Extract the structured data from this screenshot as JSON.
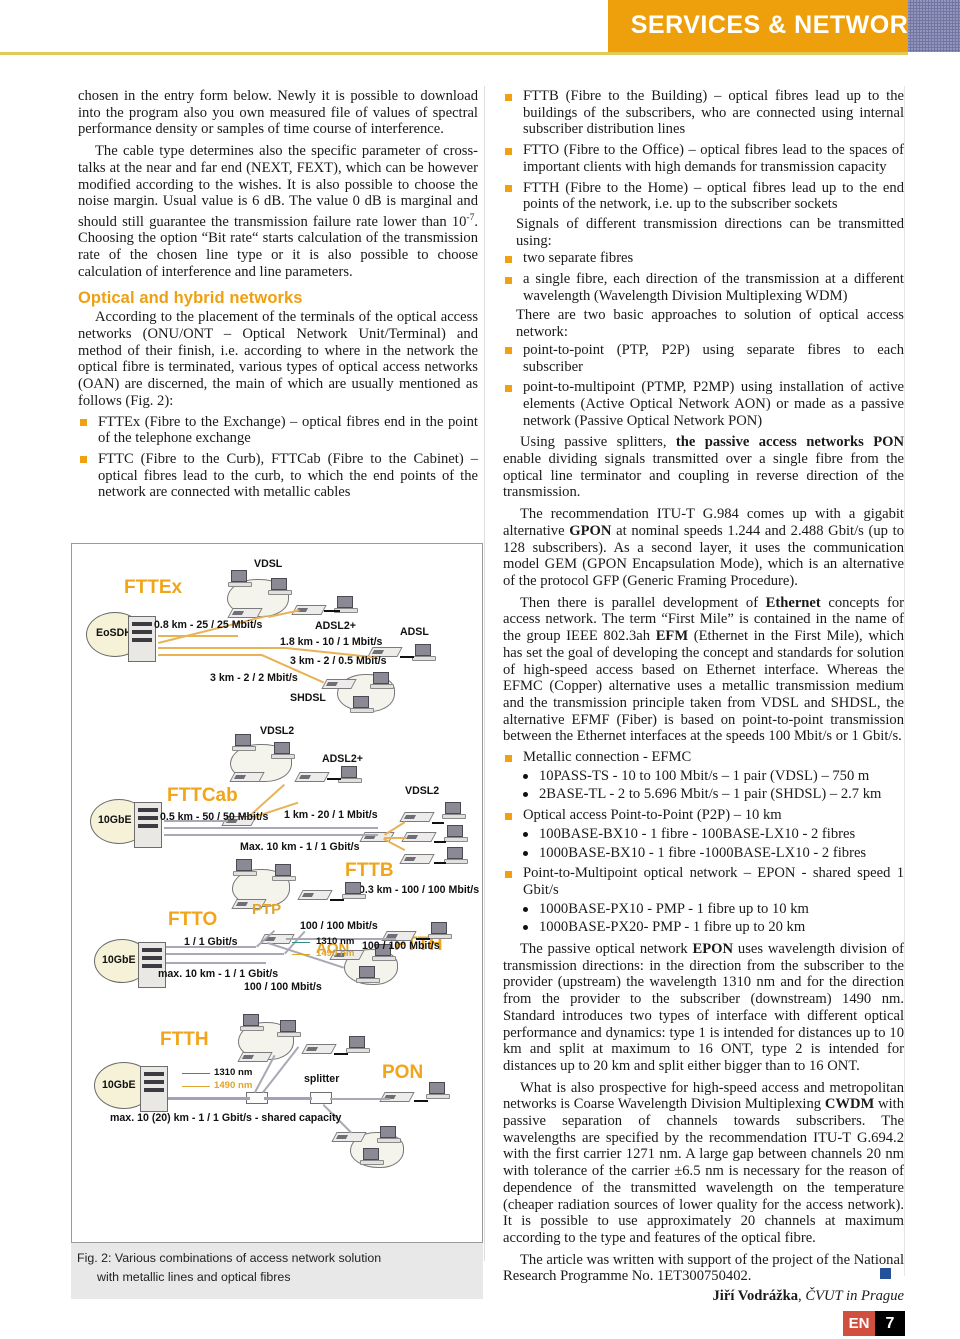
{
  "header": {
    "title": "SERVICES & NETWORKS"
  },
  "left_column": {
    "para1": "chosen in the entry form below. Newly it is possible to download into the program also you own measured file of values of spectral performance density or samples of time course of interference.",
    "para2_a": "The cable type determines also the specific parameter of cross-talks at the near and far end (NEXT, FEXT), which can be however modified according to the wishes. It is also possible to choose the noise margin. Usual value is 6 dB. The value 0 dB is marginal and should still guarantee the transmission failure rate lower than 10",
    "para2_sup": "-7",
    "para2_b": ". Choosing the option “Bit rate“ starts calculation of the transmission rate of the chosen line type or it is also possible to choose calculation of interference and line parameters.",
    "section_heading": "Optical and hybrid networks",
    "para3": "According to the placement of the terminals of the optical access networks (ONU/ONT – Optical Network Unit/Terminal) and method of their finish, i.e. according to where in the network the optical fibre is terminated, various types of optical access networks (OAN) are discerned, the main of which are usually mentioned as follows (Fig. 2):",
    "bullets": [
      "FTTEx (Fibre to the Exchange) – optical fibres end in the point of the telephone exchange",
      "FTTC (Fibre to the Curb), FTTCab (Fibre to the Cabinet) – optical fibres lead to the curb, to which the end points of the network are connected with metallic cables"
    ]
  },
  "right_column": {
    "bullets_top": [
      "FTTB (Fibre to the Building) – optical fibres lead up to the buildings of the subscribers, who are connected using internal subscriber distribution lines",
      "FTTO (Fibre to the Office) – optical fibres lead to the spaces of important clients with high demands for transmission capacity",
      "FTTH (Fibre to the Home) – optical fibres lead up to the end points of the network, i.e. up to the subscriber sockets"
    ],
    "lead_signals": "Signals of different transmission directions can be transmitted using:",
    "bullets_signals": [
      "two separate fibres",
      "a single fibre, each direction of the transmission at a different wavelength (Wavelength Division Multiplexing WDM)"
    ],
    "lead_approaches": "There are two basic approaches to solution of optical access network:",
    "bullets_approaches": [
      "point-to-point (PTP, P2P) using separate fibres to each subscriber",
      "point-to-multipoint (PTMP, P2MP) using installation of active elements (Active Optical Network AON) or made as a passive network (Passive Optical Network PON)"
    ],
    "para_pon_a": "Using passive splitters, ",
    "para_pon_bold": "the passive access networks PON",
    "para_pon_b": " enable dividing signals transmitted over a single fibre from the optical line terminator and coupling in reverse direction of the transmission.",
    "para_gpon_a": "The recommendation ITU-T G.984 comes up with a gigabit alternative ",
    "para_gpon_bold": "GPON",
    "para_gpon_b": " at nominal speeds 1.244 and 2.488 Gbit/s (up to 128 subscribers). As a second layer, it uses the communication model GEM (GPON Encapsulation Mode), which is an alternative of the protocol GFP (Generic Framing Procedure).",
    "para_eth_a": "Then there is parallel development of ",
    "para_eth_bold1": "Ethernet",
    "para_eth_b": " concepts for access network. The term “First Mile” is contained in the name of the group IEEE 802.3ah ",
    "para_eth_bold2": "EFM",
    "para_eth_c": " (Ethernet in the First Mile), which has set the goal of developing the concept and standards for solution of high-speed access based on Ethernet interface. Whereas the EFMC (Copper) alternative uses a metallic transmission medium and the transmission principle taken from VDSL and SHDSL, the alternative EFMF (Fiber) is based on point-to-point transmission between the Ethernet interfaces at the speeds 100 Mbit/s or 1 Gbit/s.",
    "spec_list": [
      {
        "label": "Metallic connection - EFMC",
        "subs": [
          "10PASS-TS - 10 to 100 Mbit/s – 1 pair (VDSL) – 750 m",
          "2BASE-TL - 2 to 5.696 Mbit/s – 1 pair (SHDSL) – 2.7 km"
        ]
      },
      {
        "label": "Optical access Point-to-Point (P2P) – 10 km",
        "subs": [
          "100BASE-BX10 - 1 fibre - 100BASE-LX10 - 2 fibres",
          "1000BASE-BX10 - 1 fibre -1000BASE-LX10 - 2 fibres"
        ]
      },
      {
        "label": "Point-to-Multipoint optical network – EPON - shared speed 1 Gbit/s",
        "subs": [
          "1000BASE-PX10 - PMP - 1 fibre up to 10 km",
          "1000BASE-PX20- PMP - 1 fibre up to 20 km"
        ]
      }
    ],
    "para_epon_a": "The passive optical network ",
    "para_epon_bold": "EPON",
    "para_epon_b": " uses wavelength division of transmission directions: in the direction from the subscriber to the provider (upstream) the wavelength 1310 nm and for the direction from the provider to the subscriber (downstream) 1490 nm. Standard introduces two types of interface with different optical performance and dynamics: type 1 is intended for distances up to 10 km and split at maximum to 16 ONT, type 2 is intended for distances up to 20 km and split either bigger than to 16 ONT.",
    "para_cwdm_a": "What is also prospective for high-speed access and metropolitan networks is Coarse Wavelength Division Multiplexing ",
    "para_cwdm_bold": "CWDM",
    "para_cwdm_b": " with passive separation of channels towards subscribers. The wavelengths are specified by the recommendation ITU-T G.694.2 with the first carrier 1271 nm. A large gap between channels 20 nm with tolerance of the carrier ±6.5 nm is necessary for the reason of dependence of the transmitted wavelength on the temperature (cheaper radiation sources of lower quality for the access network). It is possible to use approximately 20 channels at maximum according to the type and features of the optical fibre.",
    "para_ack": "The article was written with support of the project of the National Research Programme No. 1ET300750402."
  },
  "figure": {
    "caption_line1": "Fig. 2: Various combinations of access network solution",
    "caption_line2": "with metallic lines and optical fibres",
    "sections": [
      {
        "title": "FTTEx",
        "source": "EoSDH",
        "labels": [
          "VDSL",
          "ADSL2+",
          "ADSL",
          "SHDSL"
        ],
        "rates": [
          "0.8 km - 25 / 25 Mbit/s",
          "1.8 km - 10  / 1 Mbit/s",
          "3 km - 2 / 0.5 Mbit/s",
          "3 km - 2 / 2 Mbit/s"
        ]
      },
      {
        "title": "FTTCab",
        "title2": "FTTB",
        "source": "10GbE",
        "labels": [
          "VDSL2",
          "ADSL2+",
          "VDSL2"
        ],
        "rates": [
          "0.5 km - 50 / 50 Mbit/s",
          "1 km - 20 / 1 Mbit/s",
          "Max. 10 km - 1 / 1 Gbit/s",
          "0.3 km - 100 / 100 Mbit/s"
        ]
      },
      {
        "title": "FTTO",
        "title2": "FTTH",
        "source": "10GbE",
        "labels": [
          "PTP",
          "AON"
        ],
        "rates": [
          "1 / 1 Gbit/s",
          "100 / 100 Mbit/s",
          "100 / 100 Mbit/s",
          "max. 10 km - 1 / 1 Gbit/s",
          "100 / 100 Mbit/s"
        ],
        "wavelengths": [
          "1310 nm",
          "1490 nm"
        ]
      },
      {
        "title": "FTTH",
        "title2": "PON",
        "source": "10GbE",
        "labels": [
          "splitter"
        ],
        "rates": [
          "max. 10 (20) km - 1 / 1 Gbit/s - shared capacity"
        ],
        "wavelengths": [
          "1310 nm",
          "1490 nm"
        ]
      }
    ]
  },
  "footer": {
    "author": "Jiří Vodrážka",
    "affiliation": ", ČVUT in Prague",
    "lang_code": "EN",
    "page_number": "7"
  }
}
